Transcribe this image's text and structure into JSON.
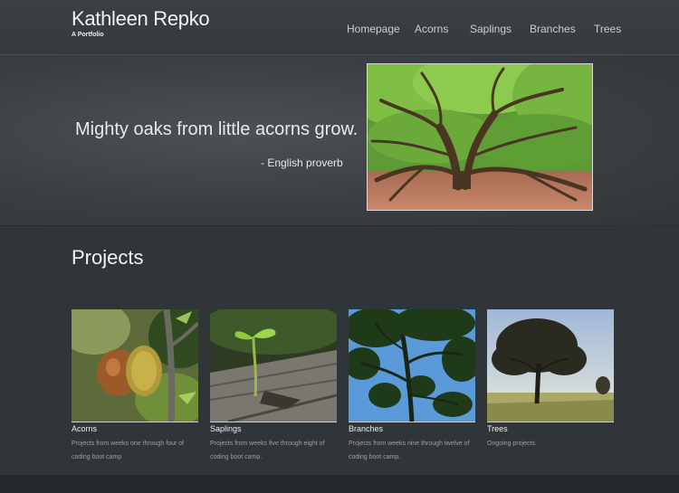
{
  "brand": {
    "title": "Kathleen Repko",
    "subtitle": "A Portfolio"
  },
  "nav": {
    "items": [
      {
        "label": "Homepage"
      },
      {
        "label": "Acorns"
      },
      {
        "label": "Saplings"
      },
      {
        "label": "Branches"
      },
      {
        "label": "Trees"
      }
    ]
  },
  "hero": {
    "quote": "Mighty oaks from little acorns grow.",
    "attribution": "- English proverb"
  },
  "projects": {
    "title": "Projects",
    "cards": [
      {
        "label": "Acorns",
        "description": "Projects from weeks one through four of coding boot camp"
      },
      {
        "label": "Saplings",
        "description": "Projects from weeks five through eight of coding boot camp."
      },
      {
        "label": "Branches",
        "description": "Projects from weeks nine through twelve of coding boot camp."
      },
      {
        "label": "Trees",
        "description": "Ongoing projects."
      }
    ]
  }
}
